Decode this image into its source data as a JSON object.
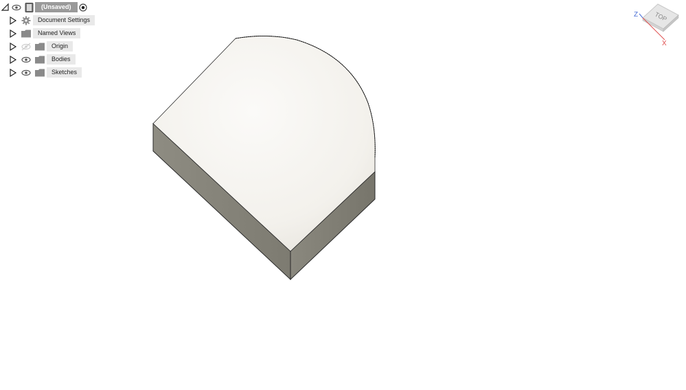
{
  "browser": {
    "root": {
      "label": "(Unsaved)"
    },
    "items": [
      {
        "label": "Document Settings",
        "icon": "gear-icon"
      },
      {
        "label": "Named Views",
        "icon": "folder-icon"
      },
      {
        "label": "Origin",
        "icon": "folder-icon",
        "visibility": "hidden"
      },
      {
        "label": "Bodies",
        "icon": "folder-icon",
        "visibility": "visible"
      },
      {
        "label": "Sketches",
        "icon": "folder-icon",
        "visibility": "visible"
      }
    ]
  },
  "viewcube": {
    "face": "TOP",
    "axis_z": "Z",
    "axis_x": "X",
    "colors": {
      "z": "#4a6fd6",
      "x": "#e05050",
      "face": "#e6e6e6"
    }
  },
  "colors": {
    "body_top": "#f4f2ee",
    "body_side": "#8c8a80",
    "label_bg": "#e9e9e9",
    "root_bg": "#9a9a9a"
  }
}
